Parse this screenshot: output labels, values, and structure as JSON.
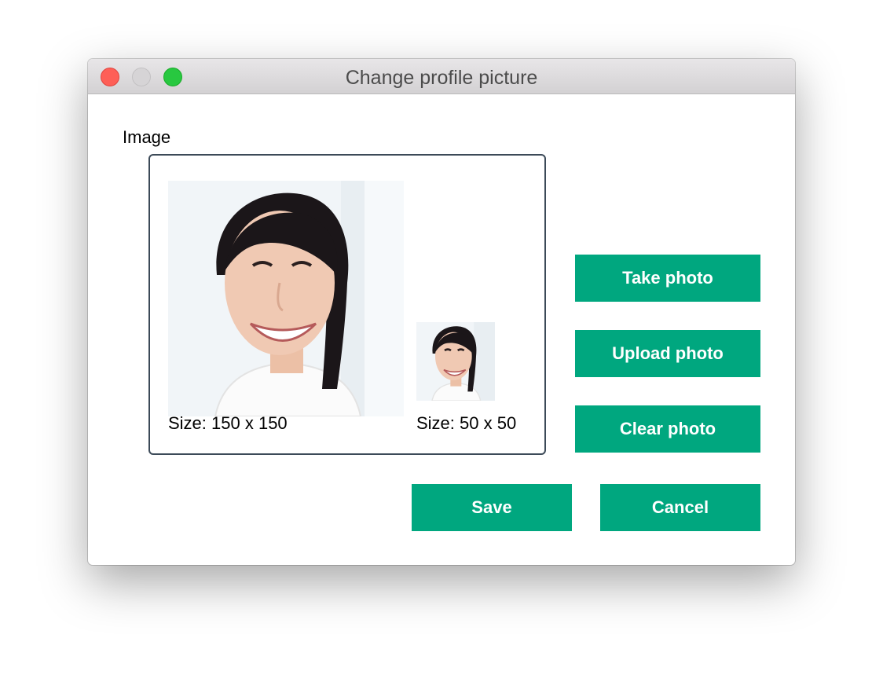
{
  "window": {
    "title": "Change profile picture"
  },
  "image_section": {
    "label": "Image",
    "large_preview": {
      "caption": "Size: 150 x 150"
    },
    "small_preview": {
      "caption": "Size: 50 x 50"
    }
  },
  "actions": {
    "take_photo": "Take photo",
    "upload_photo": "Upload photo",
    "clear_photo": "Clear photo",
    "save": "Save",
    "cancel": "Cancel"
  },
  "colors": {
    "button_accent": "#00a77f",
    "close_button": "#fe5f57",
    "minimize_button": "#d6d4d6",
    "maximize_button": "#28c840",
    "image_box_border": "#3c4a58"
  }
}
